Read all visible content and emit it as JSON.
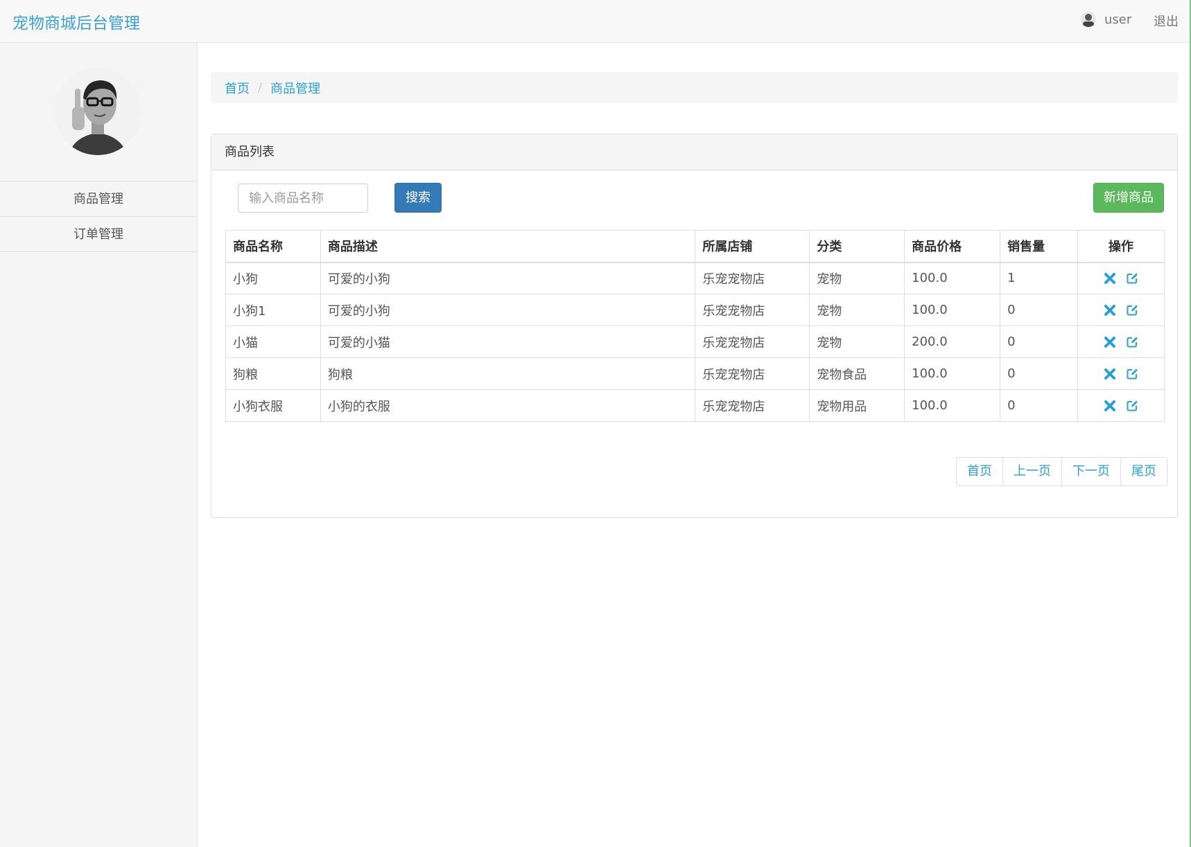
{
  "navbar": {
    "brand": "宠物商城后台管理",
    "username": "user",
    "logout": "退出"
  },
  "sidebar": {
    "items": [
      {
        "label": "商品管理"
      },
      {
        "label": "订单管理"
      }
    ]
  },
  "breadcrumb": {
    "home": "首页",
    "separator": "/",
    "current": "商品管理"
  },
  "panel": {
    "title": "商品列表",
    "search_placeholder": "输入商品名称",
    "search_button": "搜索",
    "add_button": "新增商品"
  },
  "table": {
    "headers": [
      "商品名称",
      "商品描述",
      "所属店铺",
      "分类",
      "商品价格",
      "销售量",
      "操作"
    ],
    "rows": [
      [
        "小狗",
        "可爱的小狗",
        "乐宠宠物店",
        "宠物",
        "100.0",
        "1"
      ],
      [
        "小狗1",
        "可爱的小狗",
        "乐宠宠物店",
        "宠物",
        "100.0",
        "0"
      ],
      [
        "小猫",
        "可爱的小猫",
        "乐宠宠物店",
        "宠物",
        "200.0",
        "0"
      ],
      [
        "狗粮",
        "狗粮",
        "乐宠宠物店",
        "宠物食品",
        "100.0",
        "0"
      ],
      [
        "小狗衣服",
        "小狗的衣服",
        "乐宠宠物店",
        "宠物用品",
        "100.0",
        "0"
      ]
    ],
    "row_actions": [
      "delete-icon",
      "edit-icon"
    ]
  },
  "pagination": {
    "first": "首页",
    "prev": "上一页",
    "next": "下一页",
    "last": "尾页"
  },
  "colors": {
    "link": "#2a9fd6",
    "primary": "#337ab7",
    "success": "#5cb85c"
  }
}
